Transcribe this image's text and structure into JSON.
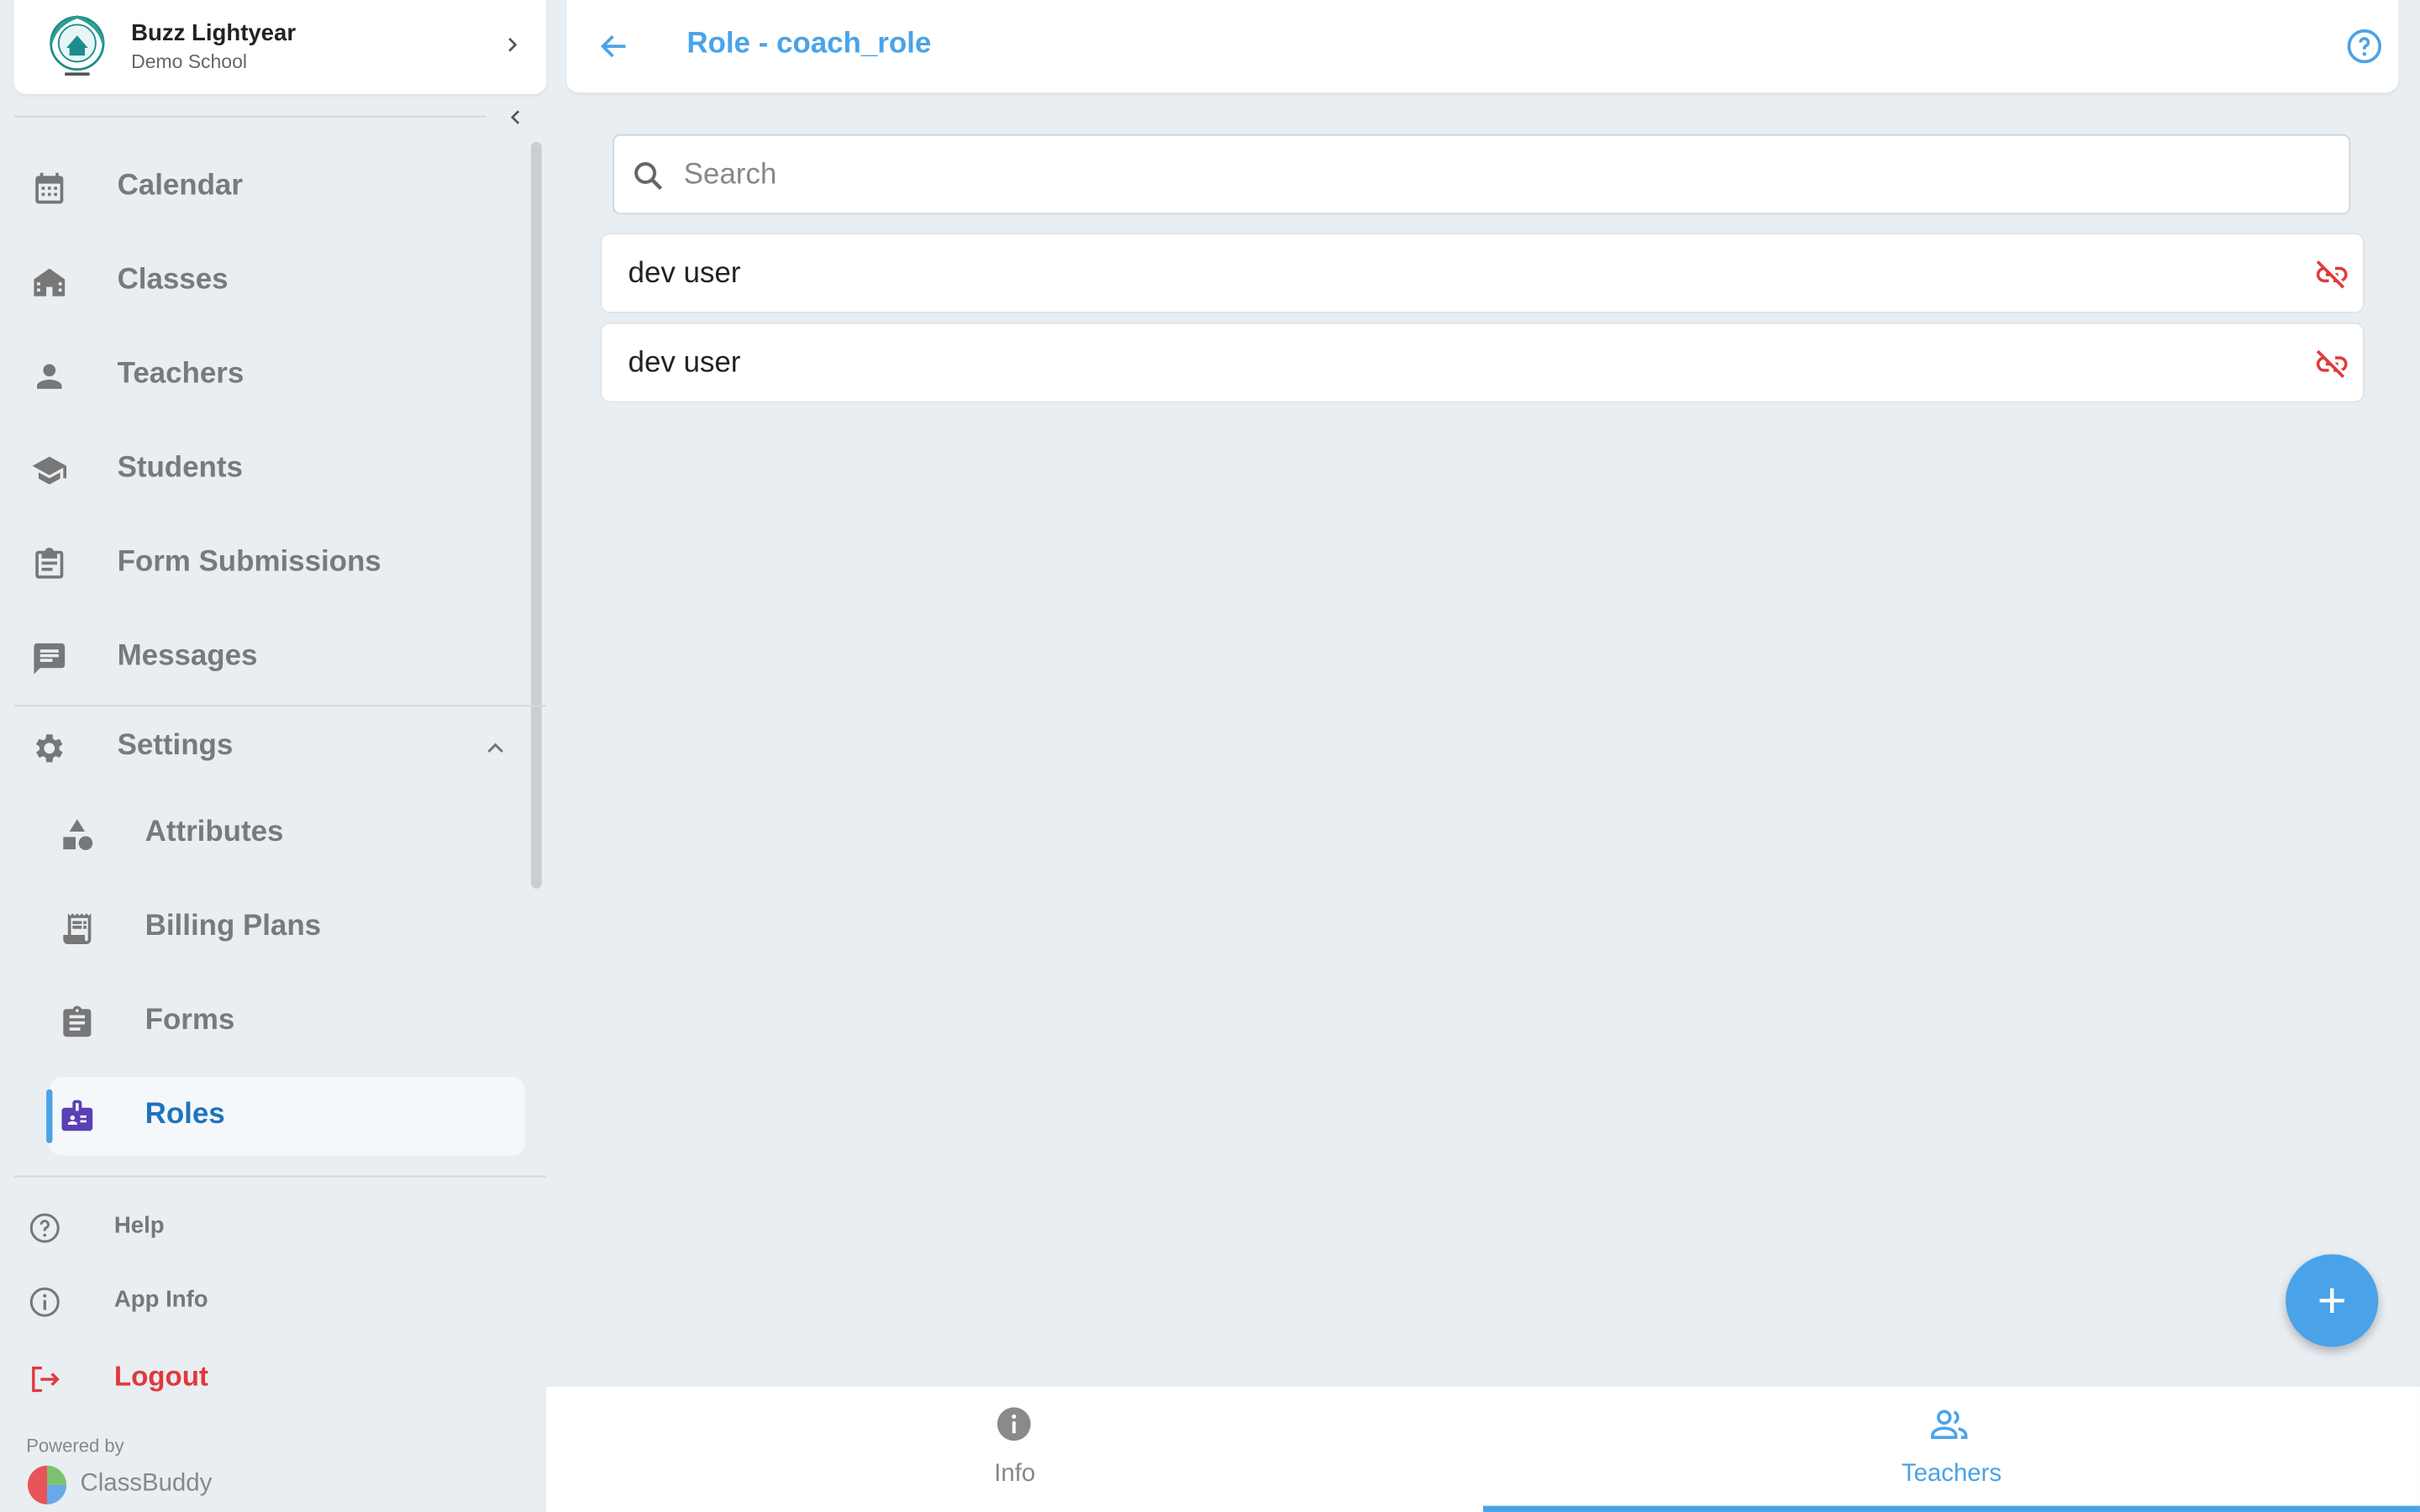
{
  "profile": {
    "name": "Buzz Lightyear",
    "school": "Demo School"
  },
  "nav": {
    "items": [
      {
        "label": "Calendar",
        "icon": "calendar-icon"
      },
      {
        "label": "Classes",
        "icon": "building-icon"
      },
      {
        "label": "Teachers",
        "icon": "person-icon"
      },
      {
        "label": "Students",
        "icon": "school-cap-icon"
      },
      {
        "label": "Form Submissions",
        "icon": "clipboard-list-icon"
      },
      {
        "label": "Messages",
        "icon": "message-icon"
      }
    ],
    "settings": {
      "label": "Settings",
      "icon": "gear-icon",
      "expanded": true,
      "items": [
        {
          "label": "Attributes",
          "icon": "shapes-icon"
        },
        {
          "label": "Billing Plans",
          "icon": "receipt-icon"
        },
        {
          "label": "Forms",
          "icon": "clipboard-icon"
        },
        {
          "label": "Roles",
          "icon": "badge-icon",
          "active": true
        }
      ]
    }
  },
  "footer": {
    "help": "Help",
    "app_info": "App Info",
    "logout": "Logout",
    "powered_by": "Powered by",
    "brand": "ClassBuddy"
  },
  "header": {
    "title": "Role - coach_role"
  },
  "search": {
    "placeholder": "Search",
    "value": ""
  },
  "members": [
    {
      "name": "dev user"
    },
    {
      "name": "dev user"
    }
  ],
  "tabs": [
    {
      "label": "Info",
      "icon": "info-icon",
      "active": false
    },
    {
      "label": "Teachers",
      "icon": "people-icon",
      "active": true
    }
  ],
  "colors": {
    "accent": "#4aa3e8",
    "active_text": "#1e73be",
    "danger": "#e03a3a",
    "background": "#e9eef3"
  }
}
